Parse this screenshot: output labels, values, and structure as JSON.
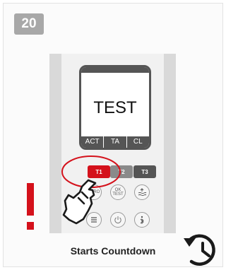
{
  "step": {
    "number": "20"
  },
  "device": {
    "screen": {
      "text": "TEST",
      "menu": [
        "ACT",
        "TA",
        "CL"
      ]
    },
    "timer_buttons": [
      {
        "label": "T1",
        "highlighted": true
      },
      {
        "label": "T2",
        "highlighted": false
      },
      {
        "label": "T3",
        "highlighted": false
      }
    ],
    "control_buttons": {
      "zero": "ZERO",
      "ok_test_line1": "OK",
      "ok_test_line2": "TEST"
    }
  },
  "annotation": {
    "alert_icon": "exclamation-mark",
    "highlight_color": "#d4111b",
    "hand_icon": "pointing-hand-icon",
    "countdown_icon": "history-icon"
  },
  "caption": {
    "text": "Starts Countdown"
  }
}
